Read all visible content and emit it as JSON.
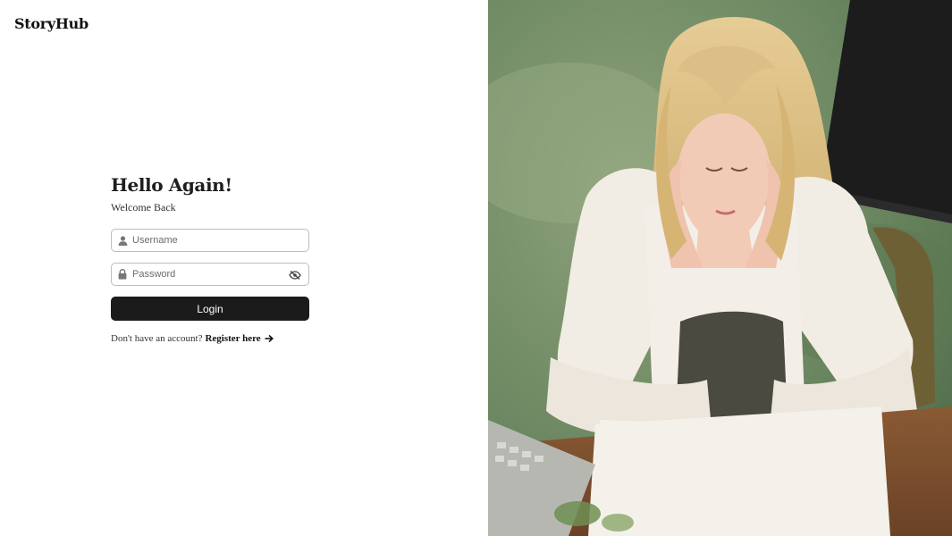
{
  "brand": {
    "name": "StoryHub"
  },
  "login": {
    "heading": "Hello Again!",
    "subheading": "Welcome Back",
    "username": {
      "placeholder": "Username",
      "value": "",
      "icon": "user-icon"
    },
    "password": {
      "placeholder": "Password",
      "value": "",
      "icon": "lock-icon",
      "toggle_icon": "eye-slash-icon"
    },
    "submit_label": "Login"
  },
  "register": {
    "prompt": "Don't have an account?",
    "link_label": "Register here",
    "link_icon": "arrow-right-icon"
  },
  "hero_image": {
    "subject": "woman reading a book at a wooden table outdoors"
  },
  "colors": {
    "button_bg": "#1b1b1b",
    "button_text": "#ffffff",
    "field_border": "#bdbdbd"
  }
}
